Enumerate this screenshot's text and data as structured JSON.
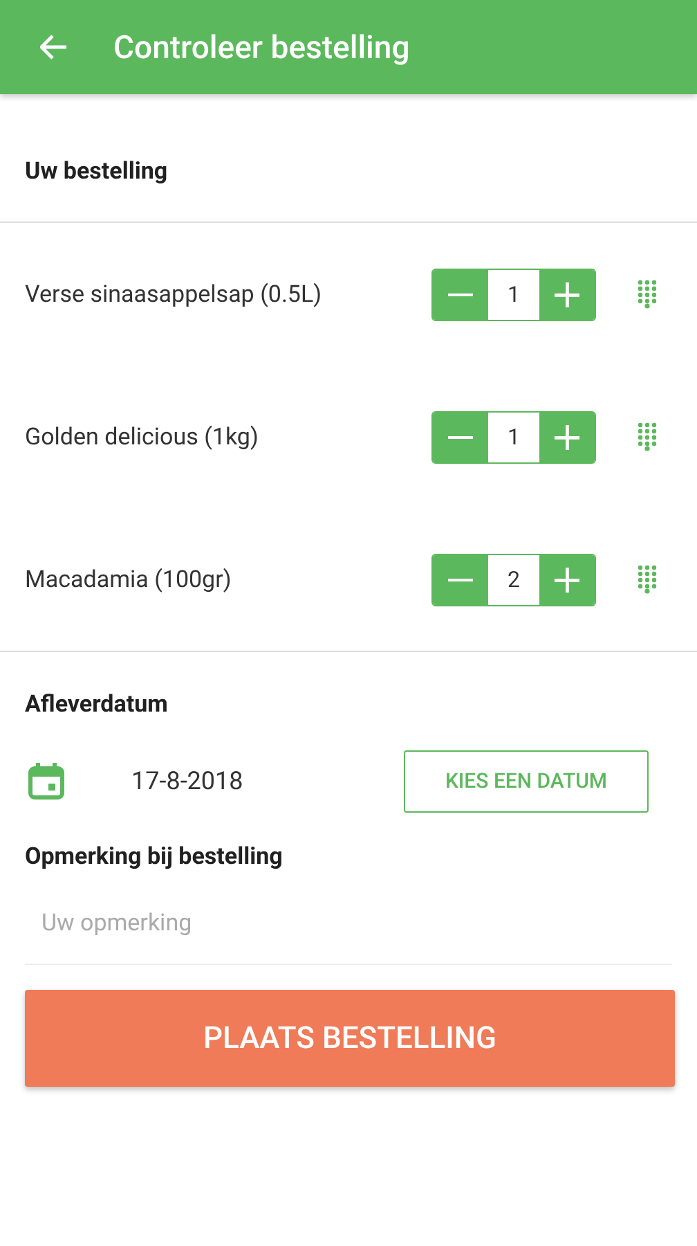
{
  "app_bar": {
    "title": "Controleer bestelling"
  },
  "order": {
    "heading": "Uw bestelling",
    "items": [
      {
        "name": "Verse sinaasappelsap (0.5L)",
        "quantity": "1"
      },
      {
        "name": "Golden delicious (1kg)",
        "quantity": "1"
      },
      {
        "name": "Macadamia (100gr)",
        "quantity": "2"
      }
    ]
  },
  "delivery": {
    "heading": "Afleverdatum",
    "date": "17-8-2018",
    "button": "KIES EEN DATUM"
  },
  "remark": {
    "heading": "Opmerking bij bestelling",
    "placeholder": "Uw opmerking"
  },
  "submit": "PLAATS BESTELLING"
}
